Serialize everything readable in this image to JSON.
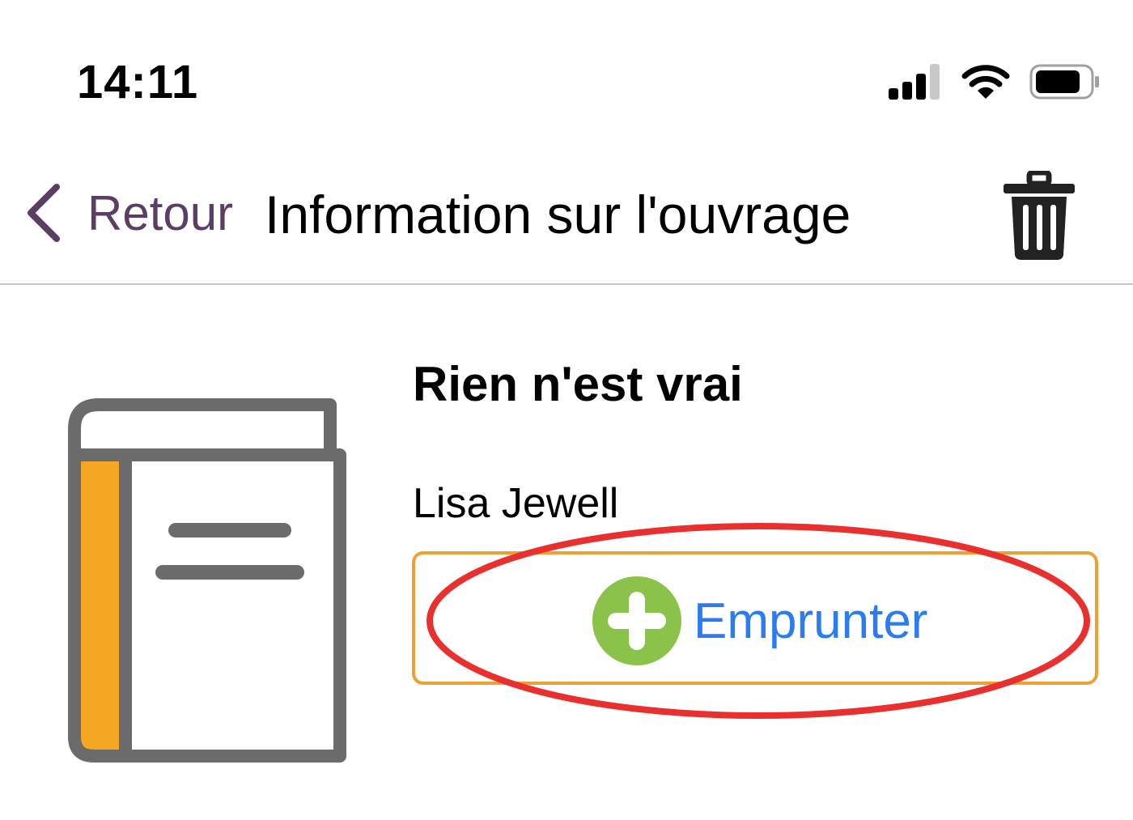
{
  "status_bar": {
    "time": "14:11",
    "icons": [
      "signal-icon",
      "wifi-icon",
      "battery-icon"
    ]
  },
  "navbar": {
    "back_label": "Retour",
    "title": "Information sur l'ouvrage",
    "trash_icon": "trash-icon"
  },
  "book": {
    "title": "Rien n'est vrai",
    "author": "Lisa Jewell",
    "cover_icon": "book-icon"
  },
  "borrow_button": {
    "label": "Emprunter",
    "icon": "plus-circle-icon"
  },
  "colors": {
    "back_accent": "#5a3e63",
    "borrow_text": "#2a7cf0",
    "borrow_border": "#f0a030",
    "plus_circle": "#8bc34a",
    "book_spine": "#f5a623",
    "book_outline": "#6b6b6b",
    "highlight": "#e8302f"
  }
}
